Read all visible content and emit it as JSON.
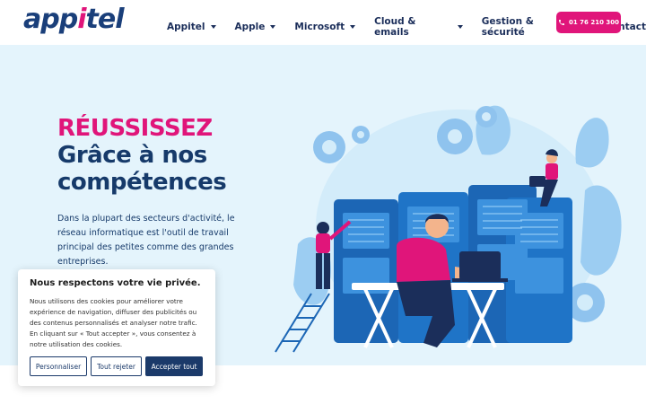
{
  "header": {
    "logo": {
      "part1": "app",
      "part2": "i",
      "part3": "tel"
    },
    "nav": [
      {
        "label": "Appitel",
        "has_dropdown": true
      },
      {
        "label": "Apple",
        "has_dropdown": true
      },
      {
        "label": "Microsoft",
        "has_dropdown": true
      },
      {
        "label": "Cloud & emails",
        "has_dropdown": true
      },
      {
        "label": "Gestion & sécurité",
        "has_dropdown": true
      },
      {
        "label": "Contact",
        "has_dropdown": false
      }
    ],
    "phone": "01 76 210 300"
  },
  "hero": {
    "title_accent": "RÉUSSISSEZ",
    "title_main": "Grâce à nos compétences",
    "text": "Dans la plupart des secteurs d'activité, le réseau informatique est l'outil de travail principal des petites comme des grandes entreprises."
  },
  "cookie": {
    "title": "Nous respectons votre vie privée.",
    "text": "Nous utilisons des cookies pour améliorer votre expérience de navigation, diffuser des publicités ou des contenus personnalisés et analyser notre trafic. En cliquant sur « Tout accepter », vous consentez à notre utilisation des cookies.",
    "btn_customize": "Personnaliser",
    "btn_reject": "Tout rejeter",
    "btn_accept": "Accepter tout"
  },
  "colors": {
    "brand_pink": "#e0157a",
    "brand_navy": "#163a6a",
    "hero_bg": "#e4f4fc"
  },
  "icons": [
    "phone-icon",
    "chevron-down-icon"
  ]
}
